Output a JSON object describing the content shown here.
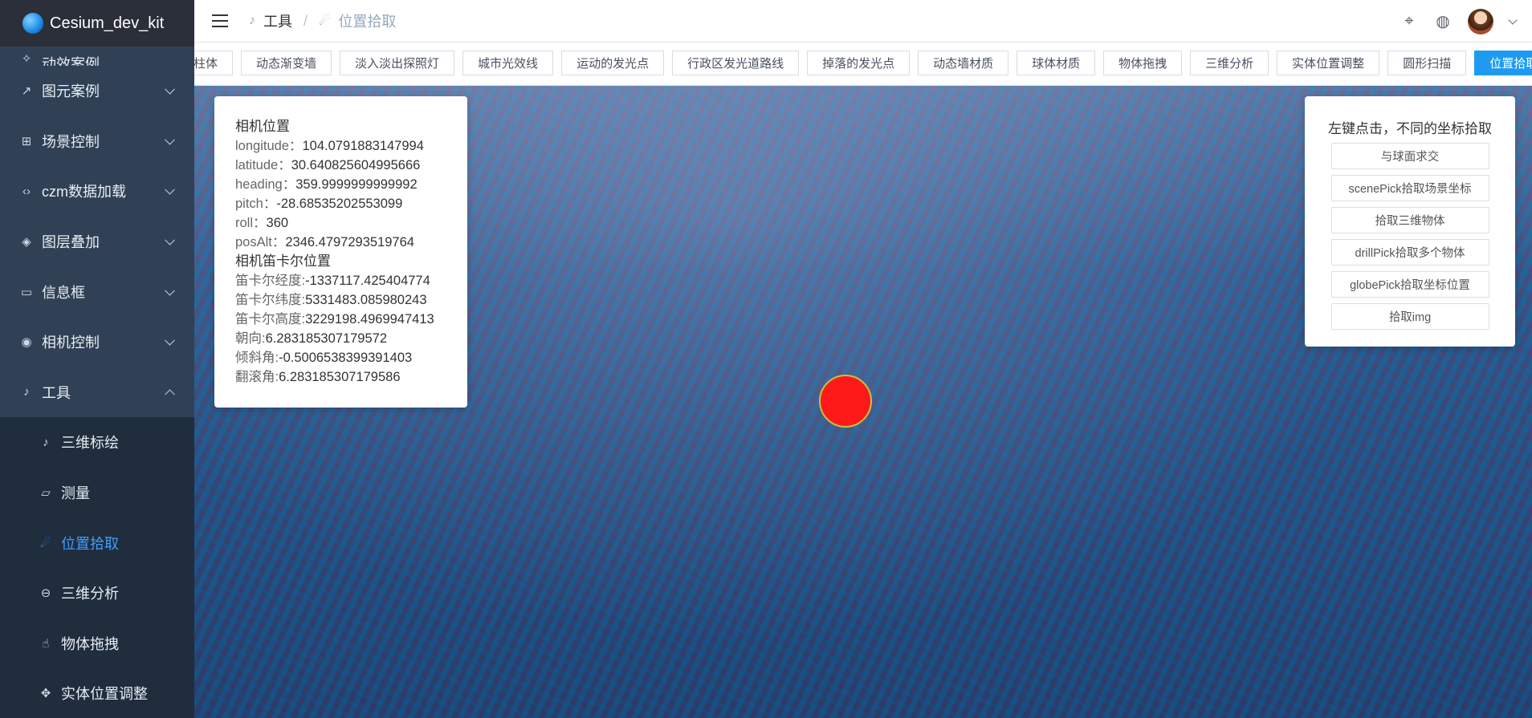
{
  "app": {
    "title": "Cesium_dev_kit"
  },
  "sidebar": {
    "partial_item": "动效案例",
    "items": [
      {
        "label": "图元案例",
        "icon": "brush-icon",
        "expanded": false
      },
      {
        "label": "场景控制",
        "icon": "scene-icon",
        "expanded": false
      },
      {
        "label": "czm数据加载",
        "icon": "code-icon",
        "expanded": false
      },
      {
        "label": "图层叠加",
        "icon": "layers-icon",
        "expanded": false
      },
      {
        "label": "信息框",
        "icon": "info-box-icon",
        "expanded": false
      },
      {
        "label": "相机控制",
        "icon": "camera-icon",
        "expanded": false
      },
      {
        "label": "工具",
        "icon": "tool-icon",
        "expanded": true
      }
    ],
    "sub_items": [
      {
        "label": "三维标绘",
        "icon": "plot-icon"
      },
      {
        "label": "测量",
        "icon": "ruler-icon"
      },
      {
        "label": "位置拾取",
        "icon": "pick-icon",
        "active": true
      },
      {
        "label": "三维分析",
        "icon": "analysis-icon"
      },
      {
        "label": "物体拖拽",
        "icon": "drag-icon"
      },
      {
        "label": "实体位置调整",
        "icon": "move-icon"
      }
    ],
    "active_color": "#409eff",
    "bg_color": "#304156"
  },
  "header": {
    "breadcrumb": [
      "工具",
      "位置拾取"
    ],
    "separator": "/"
  },
  "tags": [
    {
      "label": "柱体"
    },
    {
      "label": "动态渐变墙"
    },
    {
      "label": "淡入淡出探照灯"
    },
    {
      "label": "城市光效线"
    },
    {
      "label": "运动的发光点"
    },
    {
      "label": "行政区发光道路线"
    },
    {
      "label": "掉落的发光点"
    },
    {
      "label": "动态墙材质"
    },
    {
      "label": "球体材质"
    },
    {
      "label": "物体拖拽"
    },
    {
      "label": "三维分析"
    },
    {
      "label": "实体位置调整"
    },
    {
      "label": "圆形扫描"
    },
    {
      "label": "位置拾取",
      "active": true,
      "close": "✕"
    }
  ],
  "camera_panel": {
    "title": "相机位置",
    "rows": [
      {
        "label": "longitude：",
        "value": "104.0791883147994"
      },
      {
        "label": "latitude：",
        "value": "30.640825604995666"
      },
      {
        "label": "heading：",
        "value": "359.9999999999992"
      },
      {
        "label": "pitch：",
        "value": "-28.68535202553099"
      },
      {
        "label": "roll：",
        "value": "360"
      },
      {
        "label": "posAlt：",
        "value": "2346.4797293519764"
      }
    ],
    "cartesian_title": "相机笛卡尔位置",
    "cartesian_rows": [
      {
        "label": "笛卡尔经度:",
        "value": "-1337117.425404774"
      },
      {
        "label": "笛卡尔纬度:",
        "value": "5331483.085980243"
      },
      {
        "label": "笛卡尔高度:",
        "value": "3229198.4969947413"
      },
      {
        "label": "朝向:",
        "value": "6.283185307179572"
      },
      {
        "label": "倾斜角:",
        "value": "-0.5006538399391403"
      },
      {
        "label": "翻滚角:",
        "value": "6.283185307179586"
      }
    ]
  },
  "pick_panel": {
    "title": "左键点击，不同的坐标拾取",
    "buttons": [
      "与球面求交",
      "scenePick拾取场景坐标",
      "拾取三维物体",
      "drillPick拾取多个物体",
      "globePick拾取坐标位置",
      "拾取img"
    ]
  },
  "colors": {
    "accent": "#1e9bf0",
    "marker": "#ff1a1a"
  }
}
